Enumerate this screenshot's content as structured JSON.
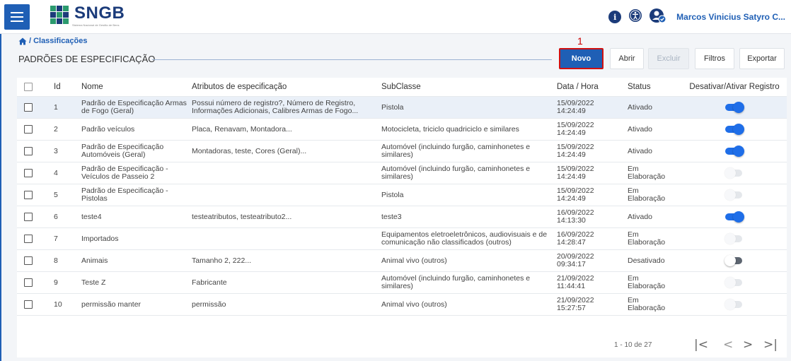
{
  "header": {
    "logo_text": "SNGB",
    "logo_subtitle": "Sistema Nacional de Gestão de Bens",
    "info_icon_glyph": "i",
    "user_name": "Marcos Vinicius Satyro C..."
  },
  "breadcrumb": {
    "separator": "/",
    "current": "Classificações"
  },
  "page": {
    "title": "PADRÕES DE ESPECIFICAÇÃO",
    "callout": "1"
  },
  "toolbar": {
    "novo": "Novo",
    "abrir": "Abrir",
    "excluir": "Excluir",
    "filtros": "Filtros",
    "exportar": "Exportar"
  },
  "table": {
    "columns": {
      "id": "Id",
      "nome": "Nome",
      "atributos": "Atributos de especificação",
      "subclasse": "SubClasse",
      "data": "Data / Hora",
      "status": "Status",
      "toggle": "Desativar/Ativar Registro"
    },
    "rows": [
      {
        "id": "1",
        "nome": "Padrão de Especificação Armas de Fogo (Geral)",
        "atributos": "Possui número de registro?, Número de Registro, Informações Adicionais, Calibres Armas de Fogo...",
        "subclasse": "Pistola",
        "data": "15/09/2022",
        "hora": "14:24:49",
        "status": "Ativado"
      },
      {
        "id": "2",
        "nome": "Padrão veículos",
        "atributos": "Placa, Renavam, Montadora...",
        "subclasse": "Motocicleta, triciclo quadriciclo e similares",
        "data": "15/09/2022",
        "hora": "14:24:49",
        "status": "Ativado"
      },
      {
        "id": "3",
        "nome": "Padrão de Especificação Automóveis (Geral)",
        "atributos": "Montadoras, teste, Cores (Geral)...",
        "subclasse": "Automóvel (incluindo furgão, caminhonetes e similares)",
        "data": "15/09/2022",
        "hora": "14:24:49",
        "status": "Ativado"
      },
      {
        "id": "4",
        "nome": "Padrão de Especificação - Veículos de Passeio 2",
        "atributos": "",
        "subclasse": "Automóvel (incluindo furgão, caminhonetes e similares)",
        "data": "15/09/2022",
        "hora": "14:24:49",
        "status": "Em Elaboração"
      },
      {
        "id": "5",
        "nome": "Padrão de Especificação - Pistolas",
        "atributos": "",
        "subclasse": "Pistola",
        "data": "15/09/2022",
        "hora": "14:24:49",
        "status": "Em Elaboração"
      },
      {
        "id": "6",
        "nome": "teste4",
        "atributos": "testeatributos, testeatributo2...",
        "subclasse": "teste3",
        "data": "16/09/2022",
        "hora": "14:13:30",
        "status": "Ativado"
      },
      {
        "id": "7",
        "nome": "Importados",
        "atributos": "",
        "subclasse": "Equipamentos eletroeletrônicos, audiovisuais e de comunicação não classificados (outros)",
        "data": "16/09/2022",
        "hora": "14:28:47",
        "status": "Em Elaboração"
      },
      {
        "id": "8",
        "nome": "Animais",
        "atributos": "Tamanho 2, 222...",
        "subclasse": "Animal vivo (outros)",
        "data": "20/09/2022",
        "hora": "09:34:17",
        "status": "Desativado"
      },
      {
        "id": "9",
        "nome": "Teste Z",
        "atributos": "Fabricante",
        "subclasse": "Automóvel (incluindo furgão, caminhonetes e similares)",
        "data": "21/09/2022",
        "hora": "11:44:41",
        "status": "Em Elaboração"
      },
      {
        "id": "10",
        "nome": "permissão manter",
        "atributos": "permissão",
        "subclasse": "Animal vivo (outros)",
        "data": "21/09/2022",
        "hora": "15:27:57",
        "status": "Em Elaboração"
      }
    ]
  },
  "pagination": {
    "info": "1 - 10 de 27",
    "first": "|<",
    "prev": "<",
    "next": ">",
    "last": ">|"
  },
  "colors": {
    "primary": "#1f5fb5",
    "brand_dark": "#1b3b7a",
    "toggle_on": "#1f6ee8",
    "highlight_border": "#d01010"
  }
}
